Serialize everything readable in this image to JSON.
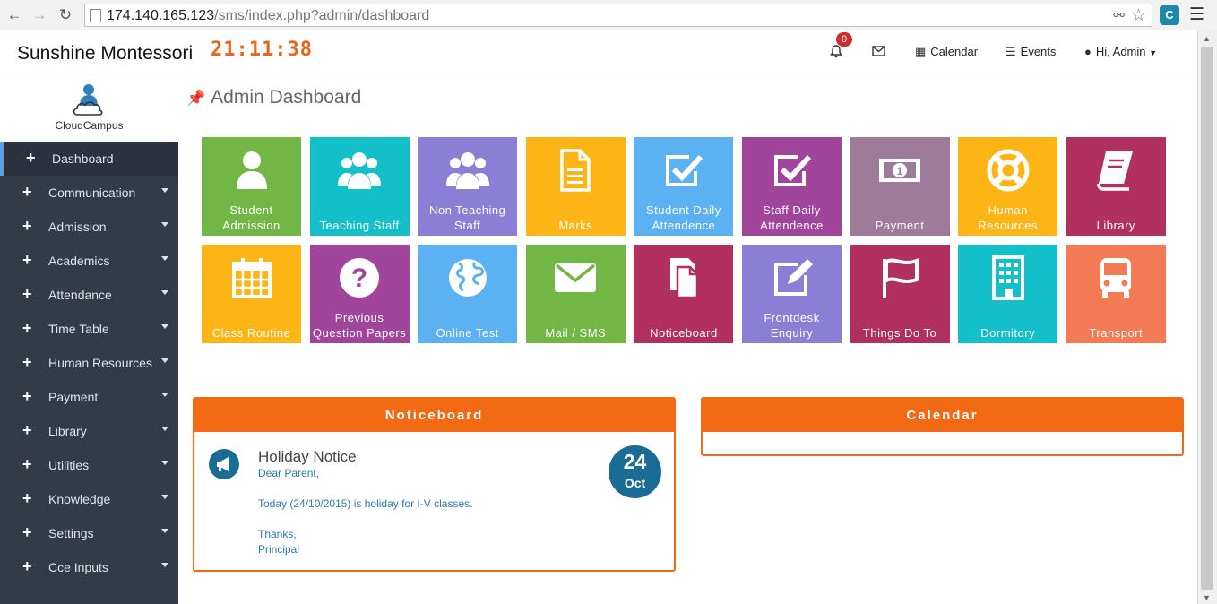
{
  "browser": {
    "url_host": "174.140.165.123",
    "url_path": "/sms/index.php?admin/dashboard"
  },
  "header": {
    "brand": "Sunshine Montessori",
    "clock": "21:11:38",
    "notification_count": "0",
    "calendar_label": "Calendar",
    "events_label": "Events",
    "user_label": "Hi, Admin"
  },
  "logo": {
    "name": "CloudCampus"
  },
  "sidebar": {
    "items": [
      {
        "label": "Dashboard",
        "active": true
      },
      {
        "label": "Communication"
      },
      {
        "label": "Admission"
      },
      {
        "label": "Academics"
      },
      {
        "label": "Attendance"
      },
      {
        "label": "Time Table"
      },
      {
        "label": "Human Resources"
      },
      {
        "label": "Payment"
      },
      {
        "label": "Library"
      },
      {
        "label": "Utilities"
      },
      {
        "label": "Knowledge"
      },
      {
        "label": "Settings"
      },
      {
        "label": "Cce Inputs"
      }
    ]
  },
  "page": {
    "title": "Admin Dashboard"
  },
  "tiles": [
    {
      "label": "Student Admission",
      "icon": "user-icon",
      "color": "#72b645"
    },
    {
      "label": "Teaching Staff",
      "icon": "group-icon",
      "color": "#13c0c9"
    },
    {
      "label": "Non Teaching Staff",
      "icon": "group-icon",
      "color": "#8a7fd4"
    },
    {
      "label": "Marks",
      "icon": "document-icon",
      "color": "#fdb515"
    },
    {
      "label": "Student Daily Attendence",
      "icon": "checkbox-icon",
      "color": "#5bb1f2"
    },
    {
      "label": "Staff Daily Attendence",
      "icon": "checkbox-icon",
      "color": "#a0449c"
    },
    {
      "label": "Payment",
      "icon": "money-icon",
      "color": "#9e7a9b"
    },
    {
      "label": "Human Resources",
      "icon": "lifebuoy-icon",
      "color": "#fdb515"
    },
    {
      "label": "Library",
      "icon": "book-icon",
      "color": "#b2305f"
    },
    {
      "label": "Class Routine",
      "icon": "calendar-icon",
      "color": "#fdb515"
    },
    {
      "label": "Previous Question Papers",
      "icon": "question-icon",
      "color": "#a0449c"
    },
    {
      "label": "Online Test",
      "icon": "globe-icon",
      "color": "#5bb1f2"
    },
    {
      "label": "Mail / SMS",
      "icon": "envelope-icon",
      "color": "#72b645"
    },
    {
      "label": "Noticeboard",
      "icon": "files-icon",
      "color": "#b2305f"
    },
    {
      "label": "Frontdesk Enquiry",
      "icon": "edit-icon",
      "color": "#8a7fd4"
    },
    {
      "label": "Things Do To",
      "icon": "flag-icon",
      "color": "#b2305f"
    },
    {
      "label": "Dormitory",
      "icon": "building-icon",
      "color": "#13c0c9"
    },
    {
      "label": "Transport",
      "icon": "bus-icon",
      "color": "#f47a55"
    }
  ],
  "noticeboard": {
    "header": "Noticeboard",
    "title": "Holiday Notice",
    "lines": [
      "Dear Parent,",
      "Today (24/10/2015) is holiday for I-V classes.",
      "Thanks,",
      "Principal"
    ],
    "day": "24",
    "month": "Oct"
  },
  "calendar": {
    "header": "Calendar"
  },
  "colors": {
    "accent": "#f36a14",
    "sidebar": "#333b47",
    "notice_blue": "#1b6c94"
  }
}
